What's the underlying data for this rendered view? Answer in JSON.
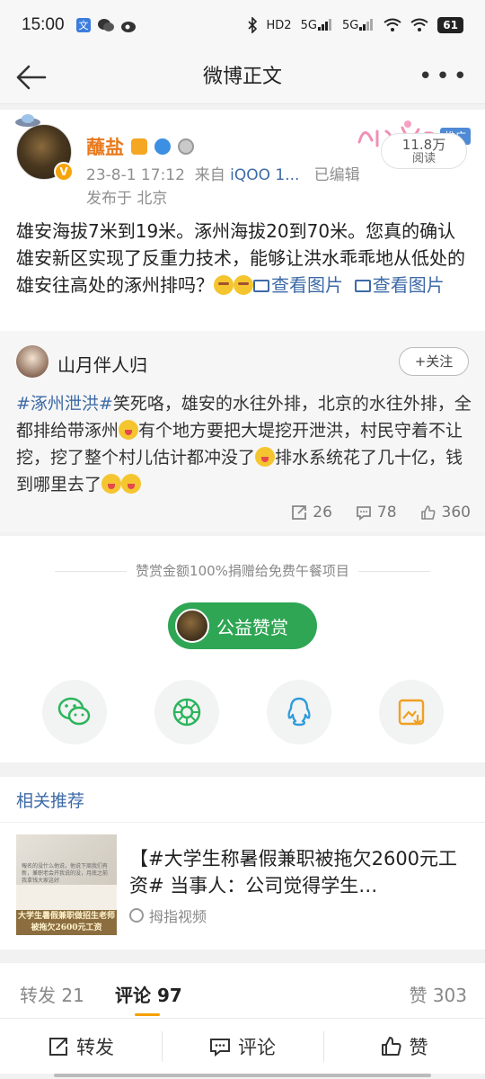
{
  "status_bar": {
    "time": "15:00",
    "battery": "61",
    "signal_labels": [
      "HD2",
      "5G",
      "5G"
    ]
  },
  "nav": {
    "title": "微博正文"
  },
  "post": {
    "author": "蘸盐",
    "timestamp": "23-8-1 17:12",
    "from_prefix": "来自",
    "source": "iQOO 1...",
    "edited": "已编辑",
    "location": "发布于 北京",
    "ad_tag": "推广",
    "read_count": "11.8万",
    "read_label": "阅读",
    "text_part1": "雄安海拔7米到19米。涿州海拔20到70米。您真的确认雄安新区实现了反重力技术，能够让洪水乖乖地从低处的雄安往高处的涿州排吗？",
    "link1": "查看图片",
    "link2": "查看图片"
  },
  "retweet": {
    "author": "山月伴人归",
    "follow_label": "+关注",
    "hashtag": "#涿州泄洪#",
    "text_a": "笑死咯，雄安的水往外排，北京的水往外排，全都排给带涿州",
    "text_b": "有个地方要把大堤挖开泄洪，村民守着不让挖，挖了整个村儿估计都冲没了",
    "text_c": "排水系统花了几十亿，钱到哪里去了",
    "reposts": "26",
    "comments": "78",
    "likes": "360"
  },
  "reward": {
    "note": "赞赏金额100%捐赠给免费午餐项目",
    "button_label": "公益赞赏"
  },
  "related": {
    "section_title": "相关推荐",
    "item_title": "【#大学生称暑假兼职被拖欠2600元工资# 当事人：公司觉得学生…",
    "item_source": "拇指视频",
    "thumb_caption": "大学生暑假兼职做招生老师 被拖欠2600元工资",
    "thumb_small_text": "報名的没什么他说，他说下周我们有新，兼职老会开我说的没，月底之前我拿钱大家这好"
  },
  "tabs": {
    "repost": "转发 21",
    "comment": "评论 97",
    "like": "赞 303"
  },
  "actions": {
    "repost": "转发",
    "comment": "评论",
    "like": "赞"
  }
}
